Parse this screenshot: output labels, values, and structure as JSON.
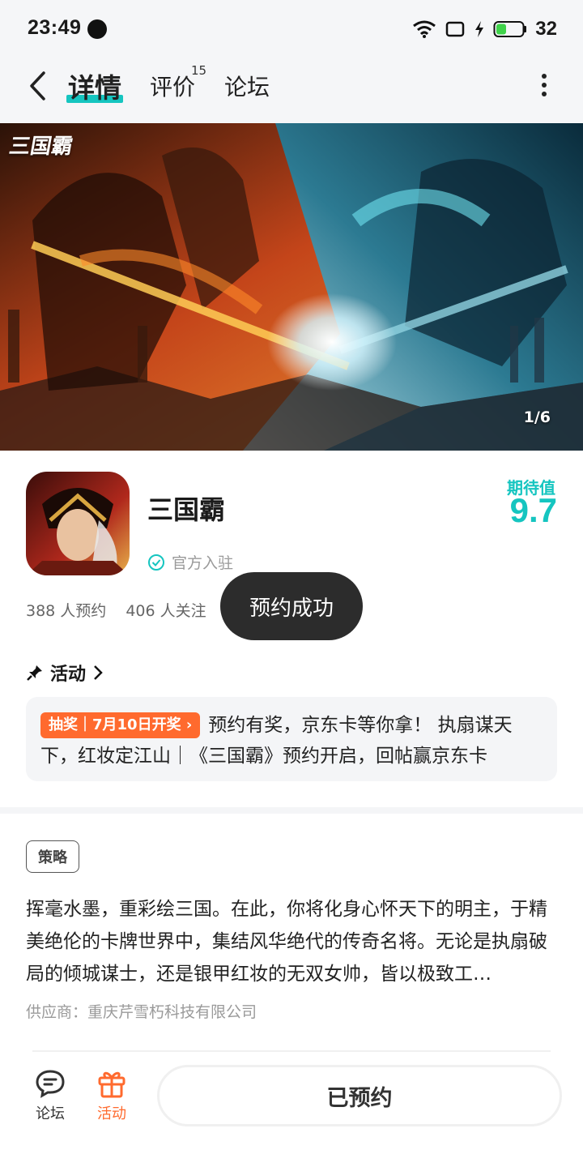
{
  "status_bar": {
    "time": "23:49",
    "battery": "32"
  },
  "nav": {
    "tabs": [
      {
        "label": "详情"
      },
      {
        "label": "评价",
        "badge": "15"
      },
      {
        "label": "论坛"
      }
    ]
  },
  "banner": {
    "logo_text": "三国霸",
    "counter": "1/6"
  },
  "app": {
    "name": "三国霸",
    "official_label": "官方入驻",
    "expect_label": "期待值",
    "expect_value": "9.7",
    "reservations": "388 人预约",
    "followers": "406 人关注"
  },
  "toast": "预约成功",
  "activity": {
    "header": "活动",
    "tag": "抽奖｜7月10日开奖",
    "text": "预约有奖，京东卡等你拿！ 执扇谋天下，红妆定江山｜《三国霸》预约开启，回帖赢京东卡"
  },
  "details": {
    "tag": "策略",
    "description": "挥毫水墨，重彩绘三国。在此，你将化身心怀天下的明主，于精美绝伦的卡牌世界中，集结风华绝代的传奇名将。无论是执扇破局的倾城谋士，还是银甲红妆的无双女帅，皆以极致工…",
    "vendor": "供应商：重庆芹雪朽科技有限公司"
  },
  "bottom_bar": {
    "forum_label": "论坛",
    "activity_label": "活动",
    "reserve_button": "已预约"
  },
  "colors": {
    "accent": "#15c5c0",
    "orange": "#ff6a2e",
    "toast_bg": "#2c2c2c"
  }
}
